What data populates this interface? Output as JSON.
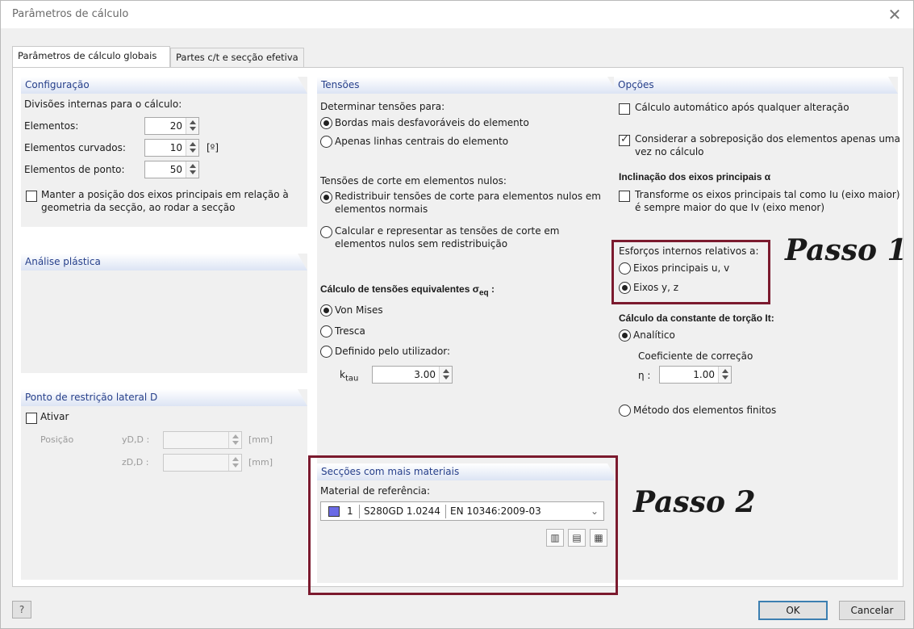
{
  "window": {
    "title": "Parâmetros de cálculo",
    "close_glyph": "✕"
  },
  "tabs": [
    {
      "label": "Parâmetros de cálculo globais",
      "active": true
    },
    {
      "label": "Partes c/t e secção efetiva",
      "active": false
    }
  ],
  "configuracao": {
    "title": "Configuração",
    "intro": "Divisões internas para o cálculo:",
    "elementos_label": "Elementos:",
    "elementos_value": "20",
    "curvados_label": "Elementos curvados:",
    "curvados_value": "10",
    "curvados_unit": "[º]",
    "ponto_label": "Elementos de ponto:",
    "ponto_value": "50",
    "manter_line1": "Manter a posição dos eixos principais em relação à",
    "manter_line2": "geometria da secção, ao rodar a secção",
    "manter_checked": false
  },
  "analise": {
    "title": "Análise plástica"
  },
  "ponto_restricao": {
    "title": "Ponto de restrição lateral D",
    "ativar_label": "Ativar",
    "ativar_checked": false,
    "posicao_label": "Posição",
    "y_label": "yD,D :",
    "z_label": "zD,D :",
    "unit": "[mm]"
  },
  "tensoes": {
    "title": "Tensões",
    "determinar_label": "Determinar tensões para:",
    "bordas_label": "Bordas mais desfavoráveis do elemento",
    "apenas_label": "Apenas linhas centrais do elemento",
    "corte_label": "Tensões de corte em elementos nulos:",
    "redistribuir_line1": "Redistribuir tensões de corte para elementos nulos em",
    "redistribuir_line2": "elementos normais",
    "calcular_line1": "Calcular e representar as tensões de corte em",
    "calcular_line2": "elementos nulos sem redistribuição",
    "equivalentes_label": "Cálculo de tensões equivalentes σ",
    "equivalentes_sub": "eq",
    "equivalentes_colon": " :",
    "vonmises_label": "Von Mises",
    "tresca_label": "Tresca",
    "definido_label": "Definido pelo utilizador:",
    "ktau_label": "k",
    "ktau_sub": "tau",
    "ktau_value": "3.00"
  },
  "seccoes": {
    "title": "Secções com mais materiais",
    "material_label": "Material de referência:",
    "material_color": "#6b6be6",
    "material_num": "1",
    "material_name": "S280GD 1.0244",
    "material_norm": "EN 10346:2009-03"
  },
  "opcoes": {
    "title": "Opções",
    "automatico_label": "Cálculo automático após qualquer alteração",
    "automatico_checked": false,
    "sobreposicao_line1": "Considerar a sobreposição dos elementos apenas uma",
    "sobreposicao_line2": "vez no cálculo",
    "sobreposicao_checked": true,
    "inclinacao_label": "Inclinação dos eixos principais α",
    "transforme_line1": "Transforme os eixos principais tal como Iu (eixo maior)",
    "transforme_line2": "é sempre maior do que Iv (eixo menor)",
    "transforme_checked": false,
    "esforcos_label": "Esforços internos relativos a:",
    "eixos_uv_label": "Eixos principais u, v",
    "eixos_yz_label": "Eixos y, z",
    "torcao_label": "Cálculo da constante de torção It:",
    "analitico_label": "Analítico",
    "coef_label": "Coeficiente de correção",
    "eta_label": "η :",
    "eta_value": "1.00",
    "mef_label": "Método dos elementos finitos"
  },
  "annotations": {
    "passo1": "Passo 1",
    "passo2": "Passo 2",
    "box_color": "#7b1a2e"
  },
  "footer": {
    "ok": "OK",
    "cancel": "Cancelar"
  }
}
